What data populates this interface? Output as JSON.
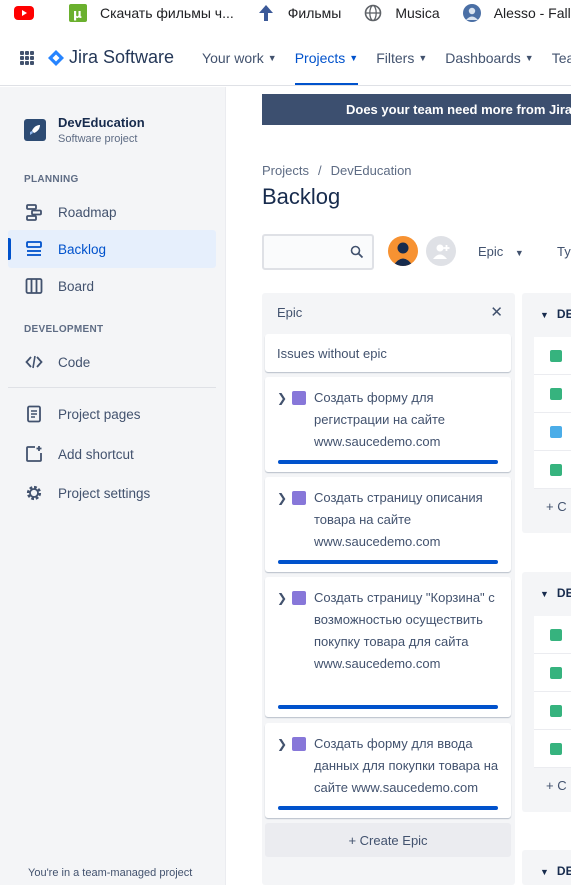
{
  "bookmarks": [
    {
      "icon": "youtube-icon",
      "label": ""
    },
    {
      "icon": "utorrent-icon",
      "label": "Скачать фильмы ч..."
    },
    {
      "icon": "arrow-up-icon",
      "label": "Фильмы"
    },
    {
      "icon": "globe-icon",
      "label": "Musica"
    },
    {
      "icon": "avatar-icon",
      "label": "Alesso - Fallin"
    }
  ],
  "topnav": {
    "logo": "Jira Software",
    "items": [
      {
        "label": "Your work",
        "active": false
      },
      {
        "label": "Projects",
        "active": true
      },
      {
        "label": "Filters",
        "active": false
      },
      {
        "label": "Dashboards",
        "active": false
      },
      {
        "label": "Teams",
        "active": false
      }
    ]
  },
  "sidebar": {
    "project_name": "DevEducation",
    "project_type": "Software project",
    "planning_heading": "PLANNING",
    "development_heading": "DEVELOPMENT",
    "items": [
      {
        "label": "Roadmap",
        "icon": "roadmap-icon"
      },
      {
        "label": "Backlog",
        "icon": "backlog-icon",
        "active": true
      },
      {
        "label": "Board",
        "icon": "board-icon"
      },
      {
        "label": "Code",
        "icon": "code-icon"
      },
      {
        "label": "Project pages",
        "icon": "page-icon"
      },
      {
        "label": "Add shortcut",
        "icon": "add-shortcut-icon"
      },
      {
        "label": "Project settings",
        "icon": "gear-icon"
      }
    ],
    "footer": "You're in a team-managed project"
  },
  "banner": "Does your team need more from Jira?",
  "breadcrumb": {
    "root": "Projects",
    "sep": "/",
    "project": "DevEducation"
  },
  "page_title": "Backlog",
  "toolbar": {
    "epic_label": "Epic",
    "type_label": "Ty"
  },
  "epic_panel": {
    "heading": "Epic",
    "no_epic": "Issues without epic",
    "epics": [
      {
        "title": "Создать форму для регистрации на сайте www.saucedemo.com",
        "progress": 1.0
      },
      {
        "title": "Создать страницу описания товара на сайте www.saucedemo.com",
        "progress": 1.0
      },
      {
        "title": "Создать страницу \"Корзина\" с возможностью осуществить покупку товара для сайта www.saucedemo.com",
        "progress": 1.0
      },
      {
        "title": "Создать форму для ввода данных для покупки товара на сайте www.saucedemo.com",
        "progress": 1.0
      }
    ],
    "create_label": "+ Create Epic"
  },
  "sprints": [
    {
      "heading": "DE",
      "rows": [
        "story",
        "story",
        "task",
        "story"
      ],
      "create": "+ C"
    },
    {
      "heading": "DE",
      "rows": [
        "story",
        "story",
        "story",
        "story"
      ],
      "create": "+ C"
    },
    {
      "heading": "DE"
    }
  ],
  "colors": {
    "accent": "#0052CC",
    "story": "#36B37E",
    "task": "#4BADE8",
    "epic": "#8777D9",
    "avatar": "#F79232"
  }
}
